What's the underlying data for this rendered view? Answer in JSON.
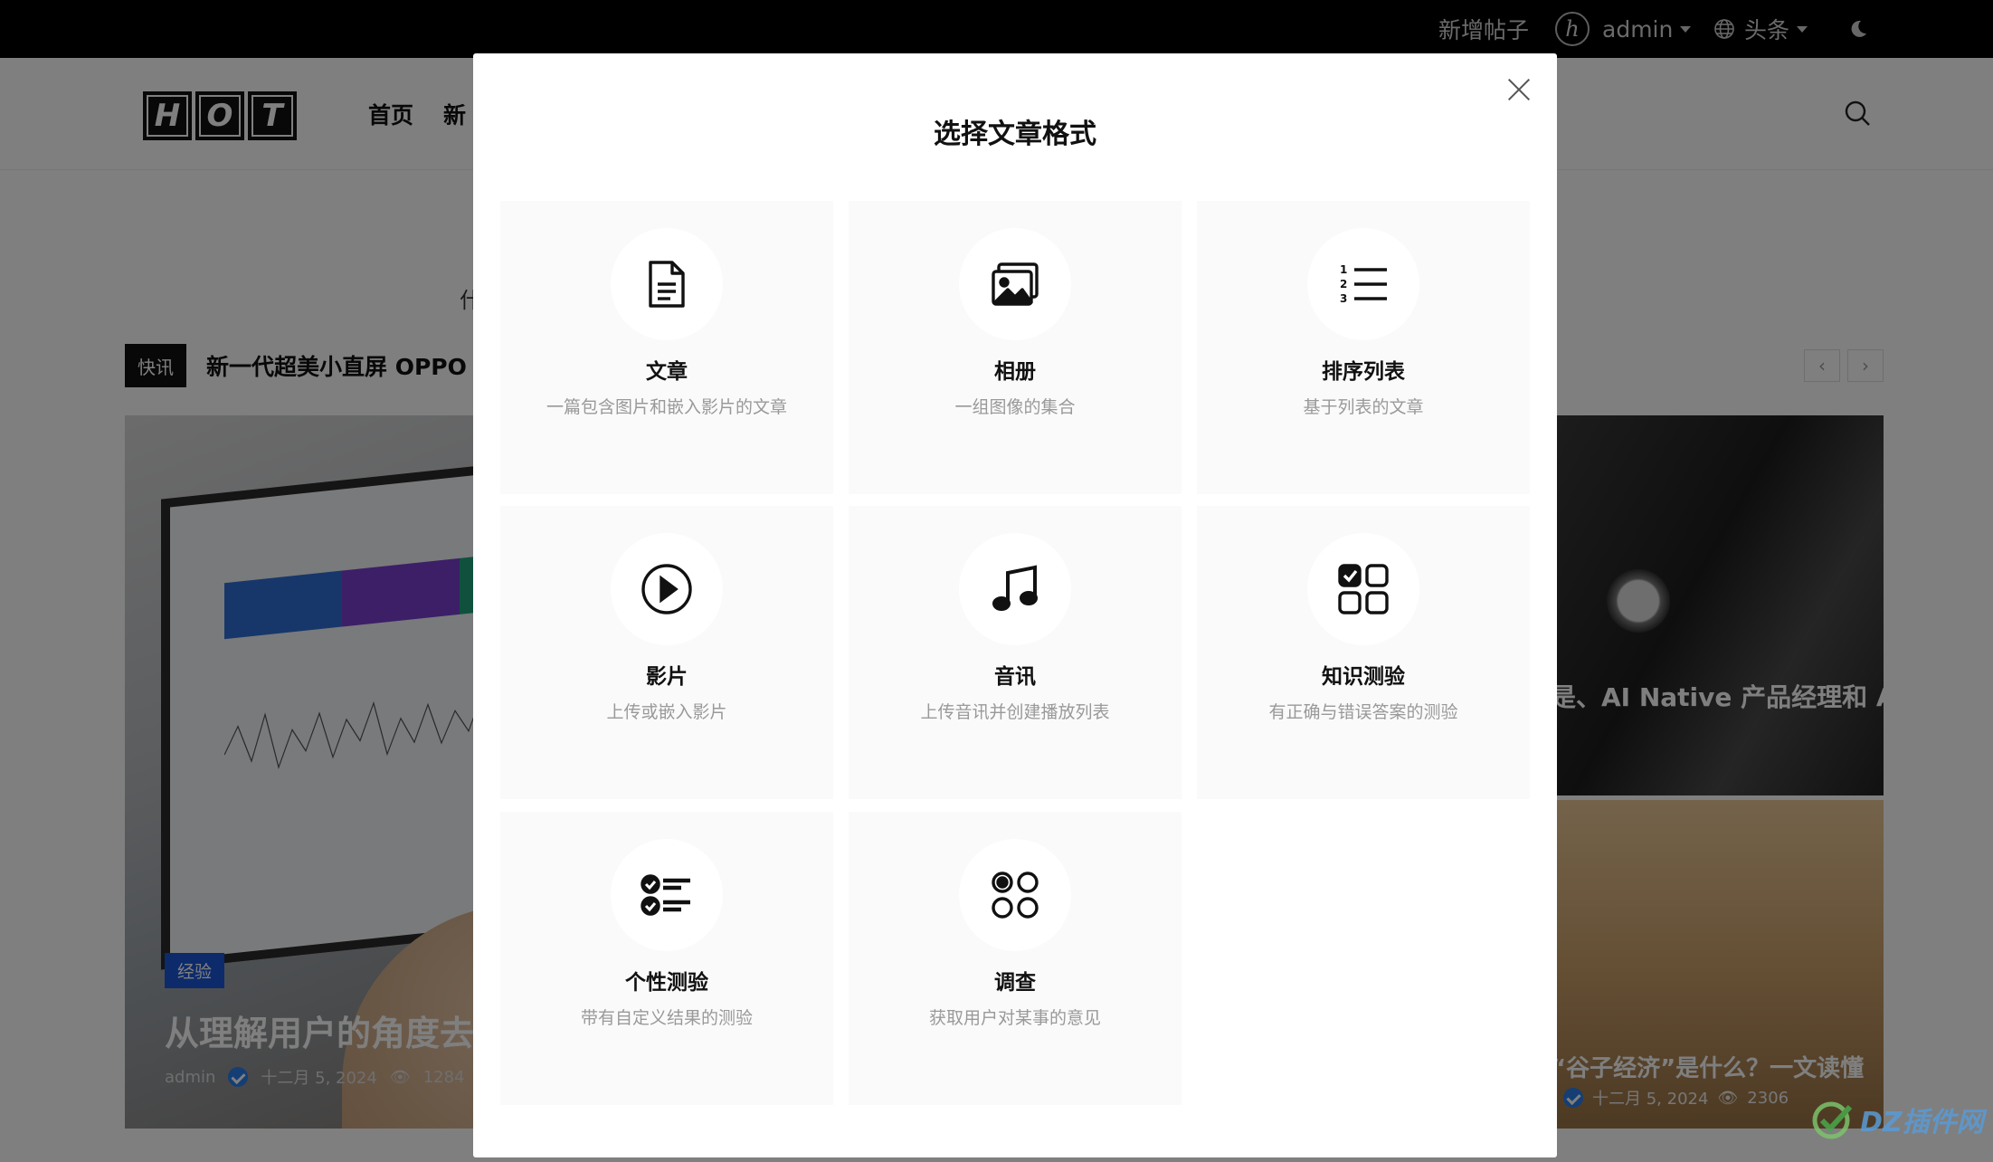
{
  "topbar": {
    "new_post": "新增帖子",
    "avatar_letter": "h",
    "user": "admin",
    "language": "头条"
  },
  "header": {
    "logo": [
      "H",
      "O",
      "T"
    ],
    "nav": [
      "首页",
      "新"
    ]
  },
  "background": {
    "flash_tag": "快讯",
    "flash_text": "新一代超美小直屏 OPPO Re",
    "mid_text": "什",
    "left_card": {
      "category": "经验",
      "title": "从理解用户的角度去理",
      "author": "admin",
      "date": "十二月 5, 2024",
      "views": "1284"
    },
    "right_card_top": {
      "title": "是、AI Native 产品经理和 AI"
    },
    "right_card_bottom": {
      "title": "“谷子经济”是什么？一文读懂",
      "date": "十二月 5, 2024",
      "views": "2306"
    }
  },
  "modal": {
    "title": "选择文章格式",
    "formats": [
      {
        "name": "文章",
        "desc": "一篇包含图片和嵌入影片的文章",
        "icon": "document-icon"
      },
      {
        "name": "相册",
        "desc": "一组图像的集合",
        "icon": "gallery-icon"
      },
      {
        "name": "排序列表",
        "desc": "基于列表的文章",
        "icon": "numbered-list-icon"
      },
      {
        "name": "影片",
        "desc": "上传或嵌入影片",
        "icon": "play-icon"
      },
      {
        "name": "音讯",
        "desc": "上传音讯并创建播放列表",
        "icon": "music-icon"
      },
      {
        "name": "知识测验",
        "desc": "有正确与错误答案的测验",
        "icon": "quiz-grid-icon"
      },
      {
        "name": "个性测验",
        "desc": "带有自定义结果的测验",
        "icon": "checklist-icon"
      },
      {
        "name": "调查",
        "desc": "获取用户对某事的意见",
        "icon": "poll-icon"
      }
    ]
  },
  "watermark": {
    "text": "DZ插件网"
  },
  "colors": {
    "topbar": "#000000",
    "accent": "#1a56d6",
    "tile": "#fafafa"
  }
}
